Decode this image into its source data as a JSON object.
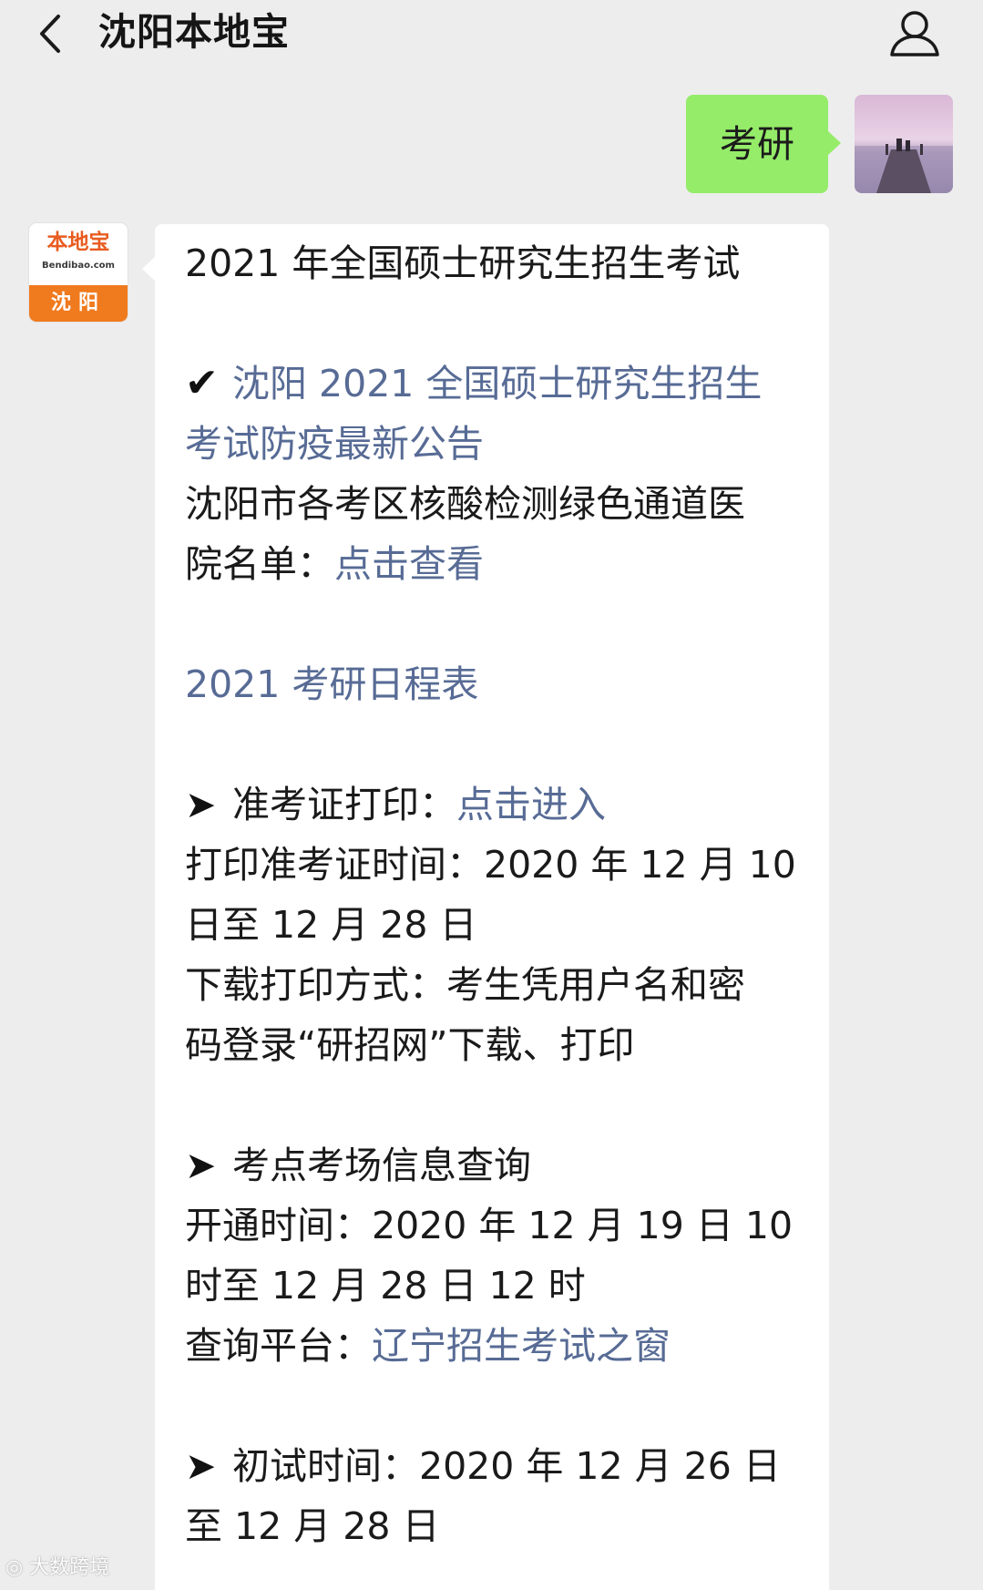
{
  "header": {
    "title": "沈阳本地宝"
  },
  "outgoing": {
    "text": "考研"
  },
  "bot": {
    "logo_top": "本地宝",
    "logo_sub": "Bendibao.com",
    "logo_city": "沈阳"
  },
  "message": {
    "heading": "2021 年全国硕士研究生招生考试",
    "notice_link_line1": "沈阳 2021 全国硕士研究生招生",
    "notice_link_line2": "考试防疫最新公告",
    "hospital_line1": "沈阳市各考区核酸检测绿色通道医",
    "hospital_line2_prefix": "院名单：",
    "hospital_link": "点击查看",
    "schedule_link": "2021 考研日程表",
    "admit_label": "准考证打印：",
    "admit_link": "点击进入",
    "admit_time_line1": "打印准考证时间：2020 年 12 月 10",
    "admit_time_line2": "日至 12 月 28 日",
    "download_line1": "下载打印方式：考生凭用户名和密",
    "download_line2": "码登录“研招网”下载、打印",
    "venue_label": "考点考场信息查询",
    "venue_time_line1": "开通时间：2020 年 12 月 19 日 10",
    "venue_time_line2": "时至 12 月 28 日 12 时",
    "venue_platform_prefix": "查询平台：",
    "venue_platform_link": "辽宁招生考试之窗",
    "exam_line1": "初试时间：2020 年 12 月 26 日",
    "exam_line2": "至 12 月 28 日"
  },
  "watermark": {
    "text": "大数跨境"
  }
}
